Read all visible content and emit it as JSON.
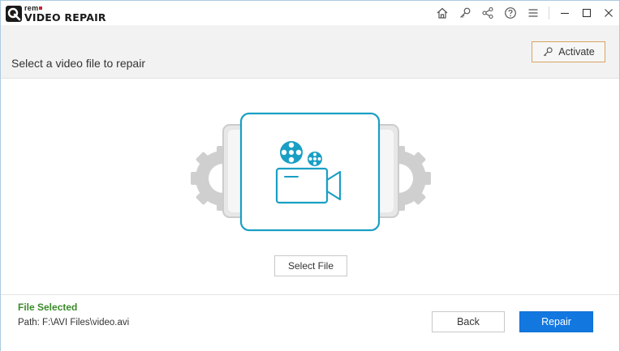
{
  "app": {
    "logo_small": "rem",
    "logo_big": "VIDEO REPAIR"
  },
  "titlebar": {
    "icons": [
      "home-icon",
      "key-icon",
      "share-icon",
      "help-icon",
      "menu-icon"
    ],
    "window_controls": [
      "minimize-icon",
      "maximize-icon",
      "close-icon"
    ]
  },
  "header": {
    "title": "Select a video file to repair",
    "activate_label": "Activate"
  },
  "main": {
    "select_file_label": "Select File",
    "illustration_icon": "video-file-gears-icon"
  },
  "footer": {
    "status": "File Selected",
    "path": "Path: F:\\AVI Files\\video.avi",
    "back_label": "Back",
    "repair_label": "Repair"
  },
  "colors": {
    "accent": "#1377e0",
    "teal": "#1a9fc4",
    "status_green": "#3b8a2a",
    "activate_border": "#d9a45e",
    "header_bg": "#f2f2f2"
  }
}
